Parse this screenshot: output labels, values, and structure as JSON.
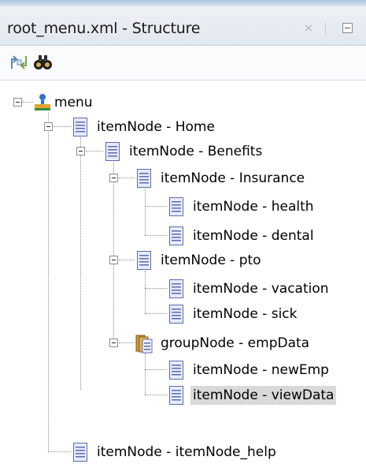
{
  "panel": {
    "title": "root_menu.xml - Structure",
    "close_glyph": "×"
  },
  "toolbar": {
    "buttons": [
      {
        "icon": "synchronize-icon"
      },
      {
        "icon": "binoculars-find-icon"
      }
    ]
  },
  "tree": {
    "nodes": [
      {
        "label": "menu",
        "icon": "menu-root-icon",
        "expanded": true
      },
      {
        "label": "itemNode - Home",
        "icon": "document-icon",
        "expanded": true
      },
      {
        "label": "itemNode - Benefits",
        "icon": "document-icon",
        "expanded": true
      },
      {
        "label": "itemNode - Insurance",
        "icon": "document-icon",
        "expanded": true
      },
      {
        "label": "itemNode - health",
        "icon": "document-icon"
      },
      {
        "label": "itemNode - dental",
        "icon": "document-icon"
      },
      {
        "label": "itemNode - pto",
        "icon": "document-icon",
        "expanded": true
      },
      {
        "label": "itemNode - vacation",
        "icon": "document-icon"
      },
      {
        "label": "itemNode - sick",
        "icon": "document-icon"
      },
      {
        "label": "groupNode - empData",
        "icon": "group-folder-icon",
        "expanded": true
      },
      {
        "label": "itemNode - newEmp",
        "icon": "document-icon"
      },
      {
        "label": "itemNode - viewData",
        "icon": "document-icon",
        "selected": true
      },
      {
        "label": "itemNode - itemNode_help",
        "icon": "document-icon"
      }
    ]
  }
}
